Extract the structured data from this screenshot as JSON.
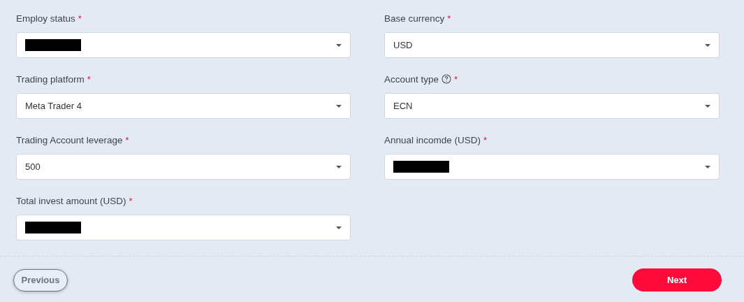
{
  "fields": [
    {
      "label": "Employ status",
      "required_mark": "*",
      "help": false,
      "redacted": true
    },
    {
      "label": "Base currency",
      "required_mark": "*",
      "help": false,
      "redacted": false,
      "value": "USD"
    },
    {
      "label": "Trading platform",
      "required_mark": "*",
      "help": false,
      "redacted": false,
      "value": "Meta Trader 4"
    },
    {
      "label": "Account type",
      "required_mark": "*",
      "help": true,
      "redacted": false,
      "value": "ECN"
    },
    {
      "label": "Trading Account leverage",
      "required_mark": "*",
      "help": false,
      "redacted": false,
      "value": "500"
    },
    {
      "label": "Annual incomde (USD)",
      "required_mark": "*",
      "help": false,
      "redacted": true
    },
    {
      "label": "Total invest amount (USD)",
      "required_mark": "*",
      "help": false,
      "redacted": true
    }
  ],
  "buttons": {
    "previous": "Previous",
    "next": "Next"
  }
}
